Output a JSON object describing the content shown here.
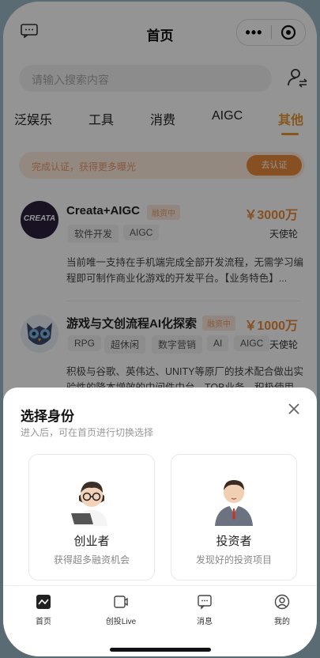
{
  "header": {
    "title": "首页",
    "more_label": "•••"
  },
  "search": {
    "placeholder": "请输入搜索内容"
  },
  "tabs": [
    {
      "label": "泛娱乐"
    },
    {
      "label": "工具"
    },
    {
      "label": "消费"
    },
    {
      "label": "AIGC"
    },
    {
      "label": "其他"
    }
  ],
  "banner": {
    "text": "完成认证，获得更多曝光",
    "button": "去认证"
  },
  "projects": [
    {
      "logo_text": "CREATA",
      "name": "Creata+AIGC",
      "stage": "融资中",
      "amount": "￥3000万",
      "tags": [
        "软件开发",
        "AIGC"
      ],
      "round": "天使轮",
      "desc": "当前唯一支持在手机端完成全部开发流程，无需学习编程即可制作商业化游戏的开发平台。【业务特色】..."
    },
    {
      "name": "游戏与文创流程AI化探索",
      "stage": "融资中",
      "amount": "￥1000万",
      "tags": [
        "RPG",
        "超休闲",
        "数字营销",
        "AI",
        "AIGC"
      ],
      "round": "天使轮",
      "desc": "积极与谷歌、英伟达、UNITY等原厂的技术配合做出实验性的降本增效的中间件中台，TOB业务。积极使用"
    }
  ],
  "sheet": {
    "title": "选择身份",
    "subtitle": "进入后，可在首页进行切换选择",
    "roles": [
      {
        "name": "创业者",
        "desc": "获得超多融资机会"
      },
      {
        "name": "投资者",
        "desc": "发现好的投资项目"
      }
    ]
  },
  "tabbar": [
    {
      "label": "首页",
      "icon": "home-chart-icon"
    },
    {
      "label": "创投Live",
      "icon": "live-icon"
    },
    {
      "label": "消息",
      "icon": "message-icon"
    },
    {
      "label": "我的",
      "icon": "profile-icon"
    }
  ],
  "colors": {
    "accent": "#e8952c",
    "amount": "#e88a3c"
  }
}
